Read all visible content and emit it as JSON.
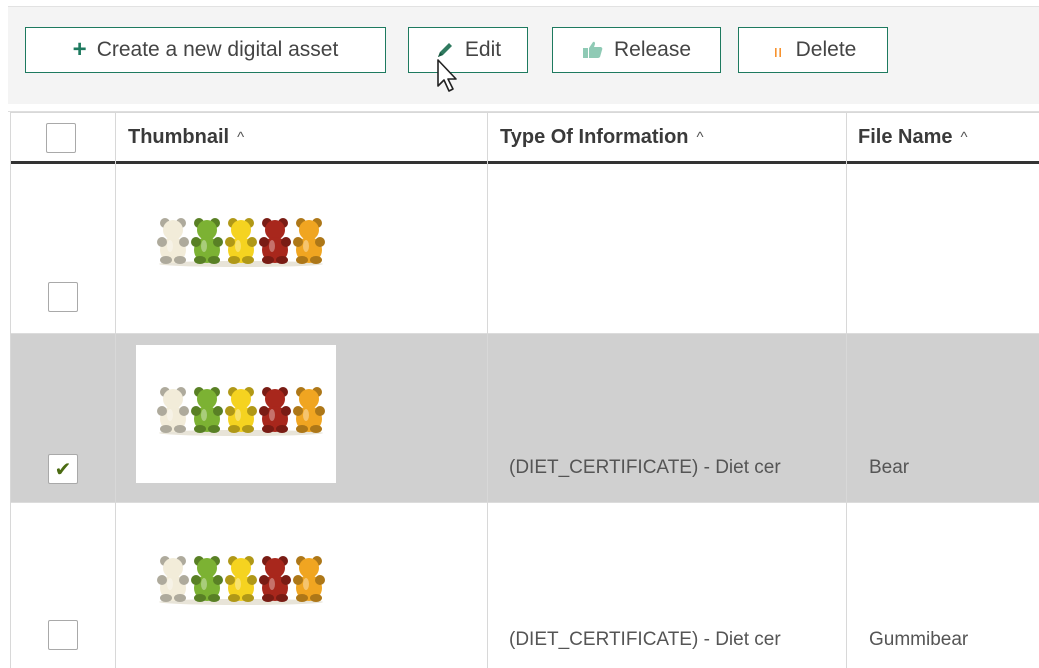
{
  "toolbar": {
    "create_label": "Create a new digital asset",
    "edit_label": "Edit",
    "release_label": "Release",
    "delete_label": "Delete"
  },
  "table": {
    "columns": [
      {
        "label": "Thumbnail",
        "sort": "^"
      },
      {
        "label": "Type Of Information",
        "sort": "^"
      },
      {
        "label": "File Name",
        "sort": "^"
      }
    ],
    "rows": [
      {
        "checked": false,
        "type_of_information": "",
        "file_name": ""
      },
      {
        "checked": true,
        "type_of_information": "(DIET_CERTIFICATE) - Diet cer",
        "file_name": "Bear"
      },
      {
        "checked": false,
        "type_of_information": "(DIET_CERTIFICATE) - Diet cer",
        "file_name": "Gummibear"
      }
    ],
    "check_mark": "✔"
  },
  "colors": {
    "accent_green": "#1e7a5f",
    "delete_orange": "#f7922e",
    "selected_row": "#d0d0d0",
    "bear_colors": [
      "#f2ecd9",
      "#7cb233",
      "#f5d320",
      "#a8271c",
      "#f0a521"
    ]
  },
  "icons": {
    "create": "plus-icon",
    "edit": "pencil-icon",
    "release": "thumbs-up-icon",
    "delete": "trash-icon"
  }
}
